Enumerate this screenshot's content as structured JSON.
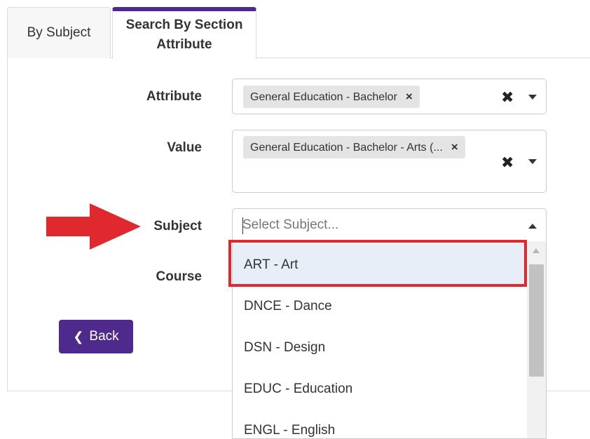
{
  "tabs": [
    {
      "label": "By Subject",
      "active": false
    },
    {
      "label": "Search By Section Attribute",
      "active": true
    }
  ],
  "form": {
    "attribute": {
      "label": "Attribute",
      "selected": "General Education - Bachelor",
      "chip_remove": "×",
      "clear": "✖"
    },
    "value": {
      "label": "Value",
      "selected": "General Education - Bachelor - Arts (...",
      "chip_remove": "×",
      "clear": "✖"
    },
    "subject": {
      "label": "Subject",
      "placeholder": "Select Subject...",
      "options": [
        "ART - Art",
        "DNCE - Dance",
        "DSN - Design",
        "EDUC - Education",
        "ENGL - English"
      ],
      "highlighted_index": 0
    },
    "course": {
      "label": "Course"
    }
  },
  "back_button": {
    "label": "Back",
    "icon": "chevron-left-icon"
  },
  "colors": {
    "accent": "#4d2a8c",
    "annotation_red": "#e0282f",
    "highlight_bg": "#e8eef7"
  }
}
